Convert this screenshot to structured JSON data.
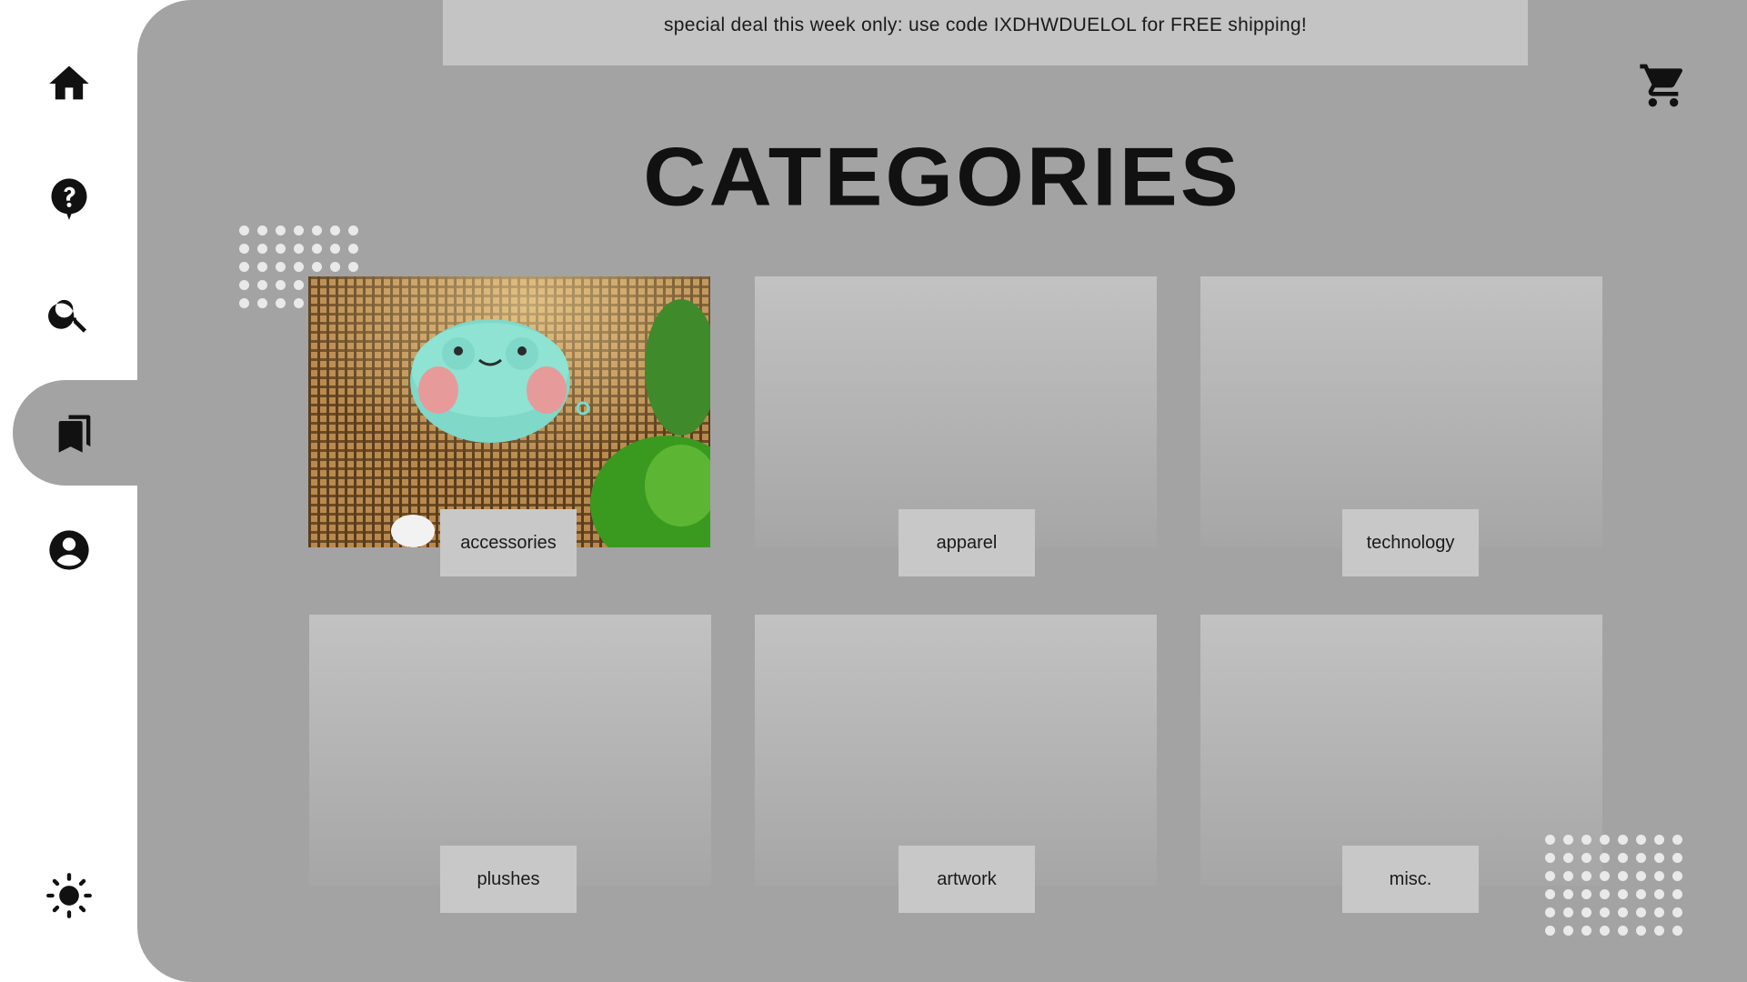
{
  "promo": {
    "text": "special deal this week only: use code IXDHWDUELOL for FREE shipping!"
  },
  "page": {
    "title": "CATEGORIES"
  },
  "sidebar": {
    "items": [
      {
        "name": "home",
        "icon": "home-icon"
      },
      {
        "name": "help",
        "icon": "help-bubble-icon"
      },
      {
        "name": "search",
        "icon": "search-icon"
      },
      {
        "name": "categories",
        "icon": "bookmarks-icon",
        "active": true
      },
      {
        "name": "account",
        "icon": "account-circle-icon"
      }
    ],
    "theme_toggle_icon": "sun-icon"
  },
  "cart": {
    "icon": "cart-icon"
  },
  "categories": [
    {
      "label": "accessories",
      "image": "frog-earbud-case-photo"
    },
    {
      "label": "apparel"
    },
    {
      "label": "technology"
    },
    {
      "label": "plushes"
    },
    {
      "label": "artwork"
    },
    {
      "label": "misc."
    }
  ],
  "colors": {
    "sidebar_bg": "#ffffff",
    "main_bg": "#a3a3a3",
    "promo_bg": "#c4c4c4",
    "card_label_bg": "#c8c8c8",
    "text": "#111111"
  }
}
